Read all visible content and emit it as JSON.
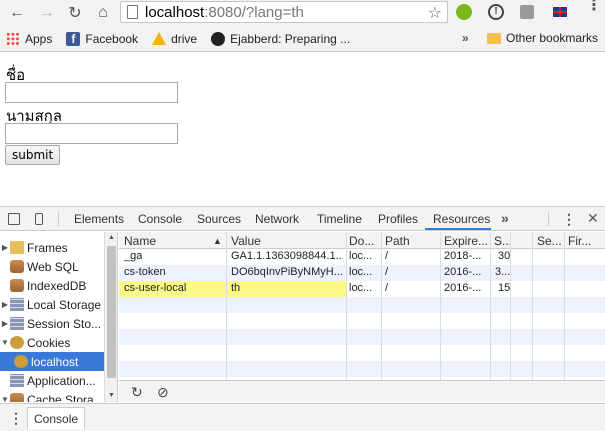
{
  "browser": {
    "url_host": "localhost",
    "url_rest": ":8080/?lang=th",
    "bookmarks": [
      {
        "label": "Apps",
        "icon": "apps-icon"
      },
      {
        "label": "Facebook",
        "icon": "facebook-icon"
      },
      {
        "label": "drive",
        "icon": "drive-icon"
      },
      {
        "label": "Ejabberd: Preparing ...",
        "icon": "github-icon"
      }
    ],
    "bookmarks_more": "»",
    "other_bookmarks": "Other bookmarks"
  },
  "form": {
    "first_name_label": "ชื่อ",
    "last_name_label": "นามสกุล",
    "first_name_value": "",
    "last_name_value": "",
    "submit_label": "submit"
  },
  "devtools": {
    "tabs": [
      "Elements",
      "Console",
      "Sources",
      "Network",
      "Timeline",
      "Profiles",
      "Resources"
    ],
    "active_tab": "Resources",
    "more_tabs": "»",
    "sidebar": [
      {
        "label": "Frames",
        "icon": "folder-icon",
        "expand": "▶"
      },
      {
        "label": "Web SQL",
        "icon": "database-icon",
        "expand": ""
      },
      {
        "label": "IndexedDB",
        "icon": "database-icon",
        "expand": ""
      },
      {
        "label": "Local Storage",
        "icon": "grid-icon",
        "expand": "▶"
      },
      {
        "label": "Session Sto...",
        "icon": "grid-icon",
        "expand": "▶"
      },
      {
        "label": "Cookies",
        "icon": "cookie-icon",
        "expand": "▼"
      },
      {
        "label": "localhost",
        "icon": "cookie-icon",
        "expand": ""
      },
      {
        "label": "Application...",
        "icon": "grid-icon",
        "expand": ""
      },
      {
        "label": "Cache Stora...",
        "icon": "database-icon",
        "expand": "▼"
      }
    ],
    "selected_sidebar": "localhost",
    "columns": [
      "Name",
      "Value",
      "Do...",
      "Path",
      "Expire...",
      "S...",
      "",
      "Se...",
      "Fir..."
    ],
    "sort_indicator": "▲",
    "rows": [
      {
        "name": "_ga",
        "value": "GA1.1.1363098844.1...",
        "domain": "loc...",
        "path": "/",
        "expires": "2018-...",
        "size": "30"
      },
      {
        "name": "cs-token",
        "value": "DO6bqInvPiByNMyH...",
        "domain": "loc...",
        "path": "/",
        "expires": "2016-...",
        "size": "3..."
      },
      {
        "name": "cs-user-local",
        "value": "th",
        "domain": "loc...",
        "path": "/",
        "expires": "2016-...",
        "size": "15"
      }
    ],
    "highlight_color": "#fbf887",
    "drawer_tab": "Console"
  }
}
